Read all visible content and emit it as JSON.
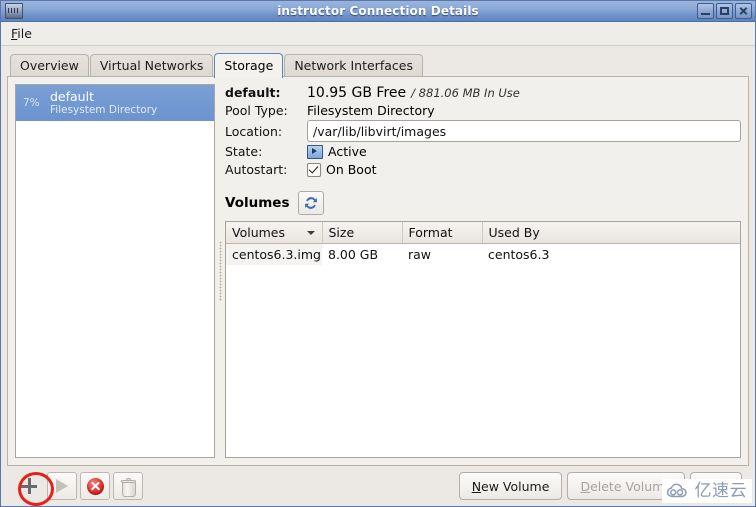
{
  "window": {
    "title": "instructor Connection Details",
    "icon": "app-icon",
    "controls": {
      "minimize": "minimize-icon",
      "maximize": "maximize-icon",
      "close": "close-icon"
    }
  },
  "menubar": {
    "items": [
      {
        "mnemonic": "F",
        "rest": "ile"
      }
    ]
  },
  "tabs": [
    {
      "label": "Overview",
      "active": false
    },
    {
      "label": "Virtual Networks",
      "active": false
    },
    {
      "label": "Storage",
      "active": true
    },
    {
      "label": "Network Interfaces",
      "active": false
    }
  ],
  "pool_list": [
    {
      "percent": "7%",
      "name": "default",
      "type": "Filesystem Directory",
      "selected": true
    }
  ],
  "details": {
    "name_label": "default:",
    "free": "10.95 GB Free",
    "in_use": "/ 881.06 MB In Use",
    "pool_type_label": "Pool Type:",
    "pool_type_value": "Filesystem Directory",
    "location_label": "Location:",
    "location_value": "/var/lib/libvirt/images",
    "state_label": "State:",
    "state_value": "Active",
    "state_icon": "active-monitor-icon",
    "autostart_label_mnemonic": "A",
    "autostart_label_rest": "utostart:",
    "autostart_value": "On Boot",
    "autostart_checked": true
  },
  "volumes_section": {
    "title": "Volumes",
    "refresh_icon": "refresh-icon",
    "columns": [
      {
        "label": "Volumes",
        "sorted": true
      },
      {
        "label": "Size",
        "sorted": false
      },
      {
        "label": "Format",
        "sorted": false
      },
      {
        "label": "Used By",
        "sorted": false
      }
    ],
    "rows": [
      {
        "volume": "centos6.3.img",
        "size": "8.00 GB",
        "format": "raw",
        "used_by": "centos6.3"
      }
    ]
  },
  "toolbar": {
    "add_pool": {
      "icon": "plus-icon",
      "enabled": true,
      "highlighted": true
    },
    "start_pool": {
      "icon": "play-icon",
      "enabled": false
    },
    "stop_pool": {
      "icon": "stop-icon",
      "enabled": true
    },
    "delete_pool": {
      "icon": "trash-icon",
      "enabled": false
    }
  },
  "actions": {
    "new_volume_mnemonic": "N",
    "new_volume_rest": "ew Volume",
    "delete_volume_mnemonic": "D",
    "delete_volume_rest": "elete Volume",
    "apply_label": ""
  },
  "watermark": {
    "text": "亿速云",
    "icon": "cloud-icon"
  },
  "colors": {
    "titlebar_blue": "#6c8fc8",
    "selection_blue": "#6b93ce",
    "active_tab_border": "#5f85bf",
    "annotation_red": "#e8201a",
    "stop_red": "#e2302a",
    "window_bg": "#ece9e4"
  }
}
